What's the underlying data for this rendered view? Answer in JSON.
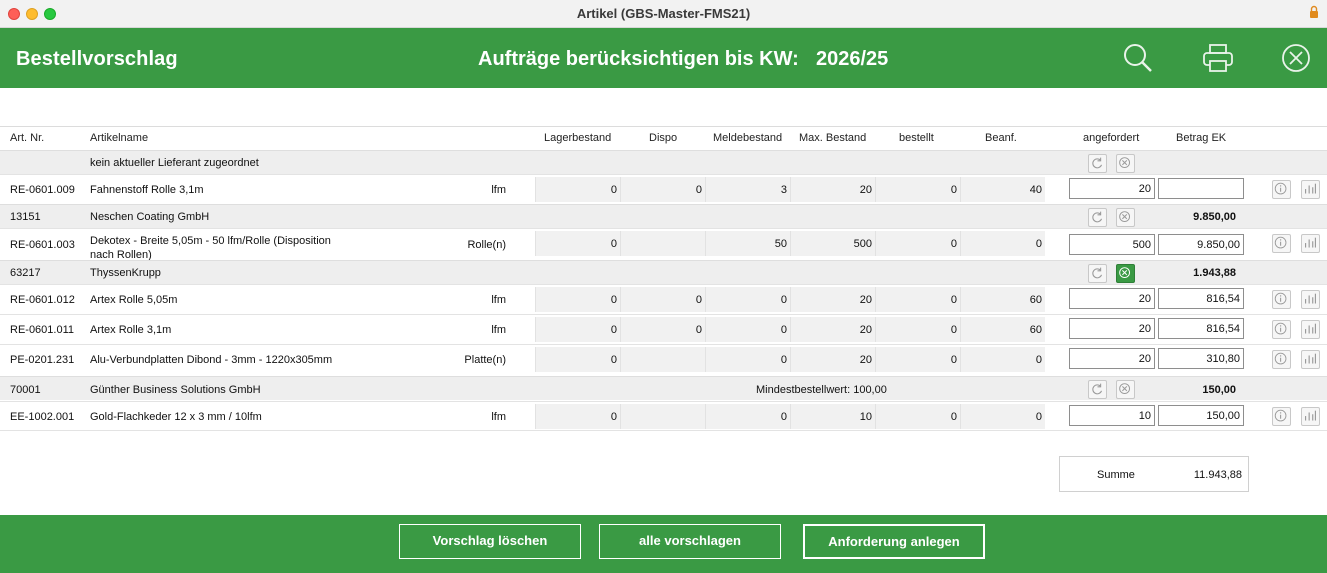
{
  "window": {
    "title": "Artikel (GBS-Master-FMS21)"
  },
  "header": {
    "title": "Bestellvorschlag",
    "orders_label": "Aufträge berücksichtigen bis KW:",
    "kw": "2026/25"
  },
  "columns": {
    "art_nr": "Art. Nr.",
    "artikelname": "Artikelname",
    "lagerbestand": "Lagerbestand",
    "dispo": "Dispo",
    "meldebestand": "Meldebestand",
    "max_bestand": "Max. Bestand",
    "bestellt": "bestellt",
    "beanf": "Beanf.",
    "angefordert": "angefordert",
    "betrag_ek": "Betrag EK"
  },
  "groups": [
    {
      "nr": "",
      "name": "kein aktueller Lieferant zugeordnet",
      "note": "",
      "betrag": "",
      "active_clear": false
    },
    {
      "nr": "13151",
      "name": "Neschen Coating GmbH",
      "note": "",
      "betrag": "9.850,00",
      "active_clear": false
    },
    {
      "nr": "63217",
      "name": "ThyssenKrupp",
      "note": "",
      "betrag": "1.943,88",
      "active_clear": true
    },
    {
      "nr": "70001",
      "name": "Günther Business Solutions GmbH",
      "note": "Mindestbestellwert: 100,00",
      "betrag": "150,00",
      "active_clear": false
    }
  ],
  "items": [
    {
      "art_nr": "RE-0601.009",
      "name": "Fahnenstoff Rolle 3,1m",
      "unit": "lfm",
      "lager": "0",
      "dispo": "0",
      "melde": "3",
      "max": "20",
      "bestellt": "0",
      "beanf": "40",
      "angefordert": "20",
      "betrag": ""
    },
    {
      "art_nr": "RE-0601.003",
      "name": "Dekotex - Breite 5,05m - 50 lfm/Rolle   (Disposition",
      "name2": "nach Rollen)",
      "unit": "Rolle(n)",
      "lager": "0",
      "dispo": "",
      "melde": "50",
      "max": "500",
      "bestellt": "0",
      "beanf": "0",
      "angefordert": "500",
      "betrag": "9.850,00"
    },
    {
      "art_nr": "RE-0601.012",
      "name": "Artex Rolle 5,05m",
      "unit": "lfm",
      "lager": "0",
      "dispo": "0",
      "melde": "0",
      "max": "20",
      "bestellt": "0",
      "beanf": "60",
      "angefordert": "20",
      "betrag": "816,54"
    },
    {
      "art_nr": "RE-0601.011",
      "name": "Artex Rolle 3,1m",
      "unit": "lfm",
      "lager": "0",
      "dispo": "0",
      "melde": "0",
      "max": "20",
      "bestellt": "0",
      "beanf": "60",
      "angefordert": "20",
      "betrag": "816,54"
    },
    {
      "art_nr": "PE-0201.231",
      "name": "Alu-Verbundplatten Dibond - 3mm - 1220x305mm",
      "unit": "Platte(n)",
      "lager": "0",
      "dispo": "",
      "melde": "0",
      "max": "20",
      "bestellt": "0",
      "beanf": "0",
      "angefordert": "20",
      "betrag": "310,80"
    },
    {
      "art_nr": "EE-1002.001",
      "name": "Gold-Flachkeder 12 x 3 mm  / 10lfm",
      "unit": "lfm",
      "lager": "0",
      "dispo": "",
      "melde": "0",
      "max": "10",
      "bestellt": "0",
      "beanf": "0",
      "angefordert": "10",
      "betrag": "150,00"
    }
  ],
  "summary": {
    "label": "Summe",
    "value": "11.943,88"
  },
  "footer": {
    "delete_label": "Vorschlag löschen",
    "suggest_all_label": "alle vorschlagen",
    "create_label": "Anforderung anlegen"
  },
  "colors": {
    "accent": "#3a9a44",
    "row_group": "#eeeeee"
  },
  "icons": {
    "header": [
      "search-icon",
      "print-icon",
      "close-circle-icon"
    ],
    "group": [
      "refresh-icon",
      "clear-icon"
    ],
    "row": [
      "info-icon",
      "chart-icon"
    ]
  }
}
